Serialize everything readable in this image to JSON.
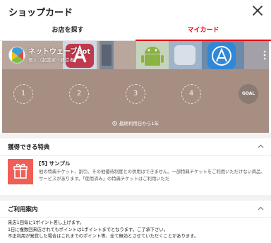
{
  "header": {
    "title": "ショップカード",
    "close_icon": "close-icon"
  },
  "tabs": [
    {
      "label": "お店を探す",
      "active": false
    },
    {
      "label": "マイカード",
      "active": true
    }
  ],
  "card": {
    "shop_name": "ネットウェーブbot",
    "shop_type": "個人（起業家・経営者）",
    "stamps": [
      "1",
      "2",
      "3",
      "4"
    ],
    "goal_label": "GOAL",
    "expiry_text": "最終利用日から1年",
    "background_color": "#a68e82",
    "logo_icon": "shop-logo-icon",
    "menu_icon": "more-vertical-icon"
  },
  "benefits": {
    "heading": "獲得できる特典",
    "ticket": {
      "name": "[5] サンプル",
      "description": "他の特典チケット、割引、その他優待制度との併用はできません。一部特典チケットをご利用いただけない商品、サービスがあります。「使用済み」の特典チケットはご利用いただ",
      "icon": "gift-icon",
      "icon_color": "#ef5f56"
    }
  },
  "usage_guide": {
    "heading": "ご利用案内",
    "lines": [
      "来店1回毎に1ポイント差し上げます。",
      "1日に複数回来店されてもポイントは1ポイントまでとなります。ご了承下さい。",
      "不正利用が発覚した場合はこれまでのポイント等、全て無効とさせていただくことがあります。"
    ]
  },
  "colors": {
    "accent": "#e60012"
  }
}
